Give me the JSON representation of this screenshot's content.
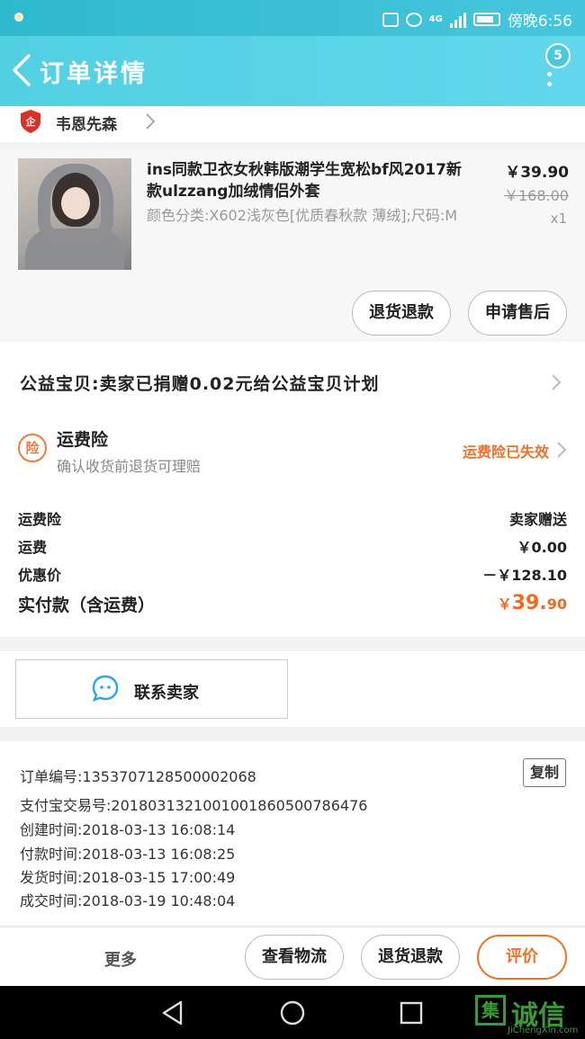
{
  "status_bar": {
    "network": "4G",
    "time_text": "傍晚6:56"
  },
  "nav": {
    "title": "订单详情",
    "badge_count": "5"
  },
  "shop": {
    "name": "韦恩先森"
  },
  "product": {
    "name": "ins同款卫衣女秋韩版潮学生宽松bf风2017新款ulzzang加绒情侣外套",
    "sku": "颜色分类:X602浅灰色[优质春秋款 薄绒];尺码:M",
    "price": "￥39.90",
    "original_price": "￥168.00",
    "quantity": "x1",
    "btn_refund": "退货退款",
    "btn_aftersale": "申请售后"
  },
  "charity": {
    "text": "公益宝贝:卖家已捐赠0.02元给公益宝贝计划"
  },
  "insurance": {
    "icon_char": "险",
    "title": "运费险",
    "subtitle": "确认收货前退货可理赔",
    "status": "运费险已失效"
  },
  "fees": {
    "rows": [
      {
        "label": "运费险",
        "value": "卖家赠送"
      },
      {
        "label": "运费",
        "value": "￥0.00"
      },
      {
        "label": "优惠价",
        "value": "－￥128.10"
      }
    ],
    "total_label": "实付款（含运费）",
    "total_currency": "￥",
    "total_int": "39.",
    "total_dec": "90"
  },
  "contact": {
    "label": "联系卖家"
  },
  "order_info": {
    "copy_label": "复制",
    "rows": [
      {
        "label": "订单编号:",
        "value": "1353707128500002068"
      },
      {
        "label": "支付宝交易号:",
        "value": "2018031321001001860500786476"
      },
      {
        "label": "创建时间:",
        "value": "2018-03-13 16:08:14"
      },
      {
        "label": "付款时间:",
        "value": "2018-03-13 16:08:25"
      },
      {
        "label": "发货时间:",
        "value": "2018-03-15 17:00:49"
      },
      {
        "label": "成交时间:",
        "value": "2018-03-19 10:48:04"
      }
    ]
  },
  "bottom": {
    "more": "更多",
    "logistics": "查看物流",
    "refund": "退货退款",
    "review": "评价"
  },
  "watermark": {
    "box": "集",
    "text": "诚信",
    "sub": "JiChengXin.com"
  },
  "colors": {
    "header": "#52d0e2",
    "accent_orange": "#f0702a"
  }
}
